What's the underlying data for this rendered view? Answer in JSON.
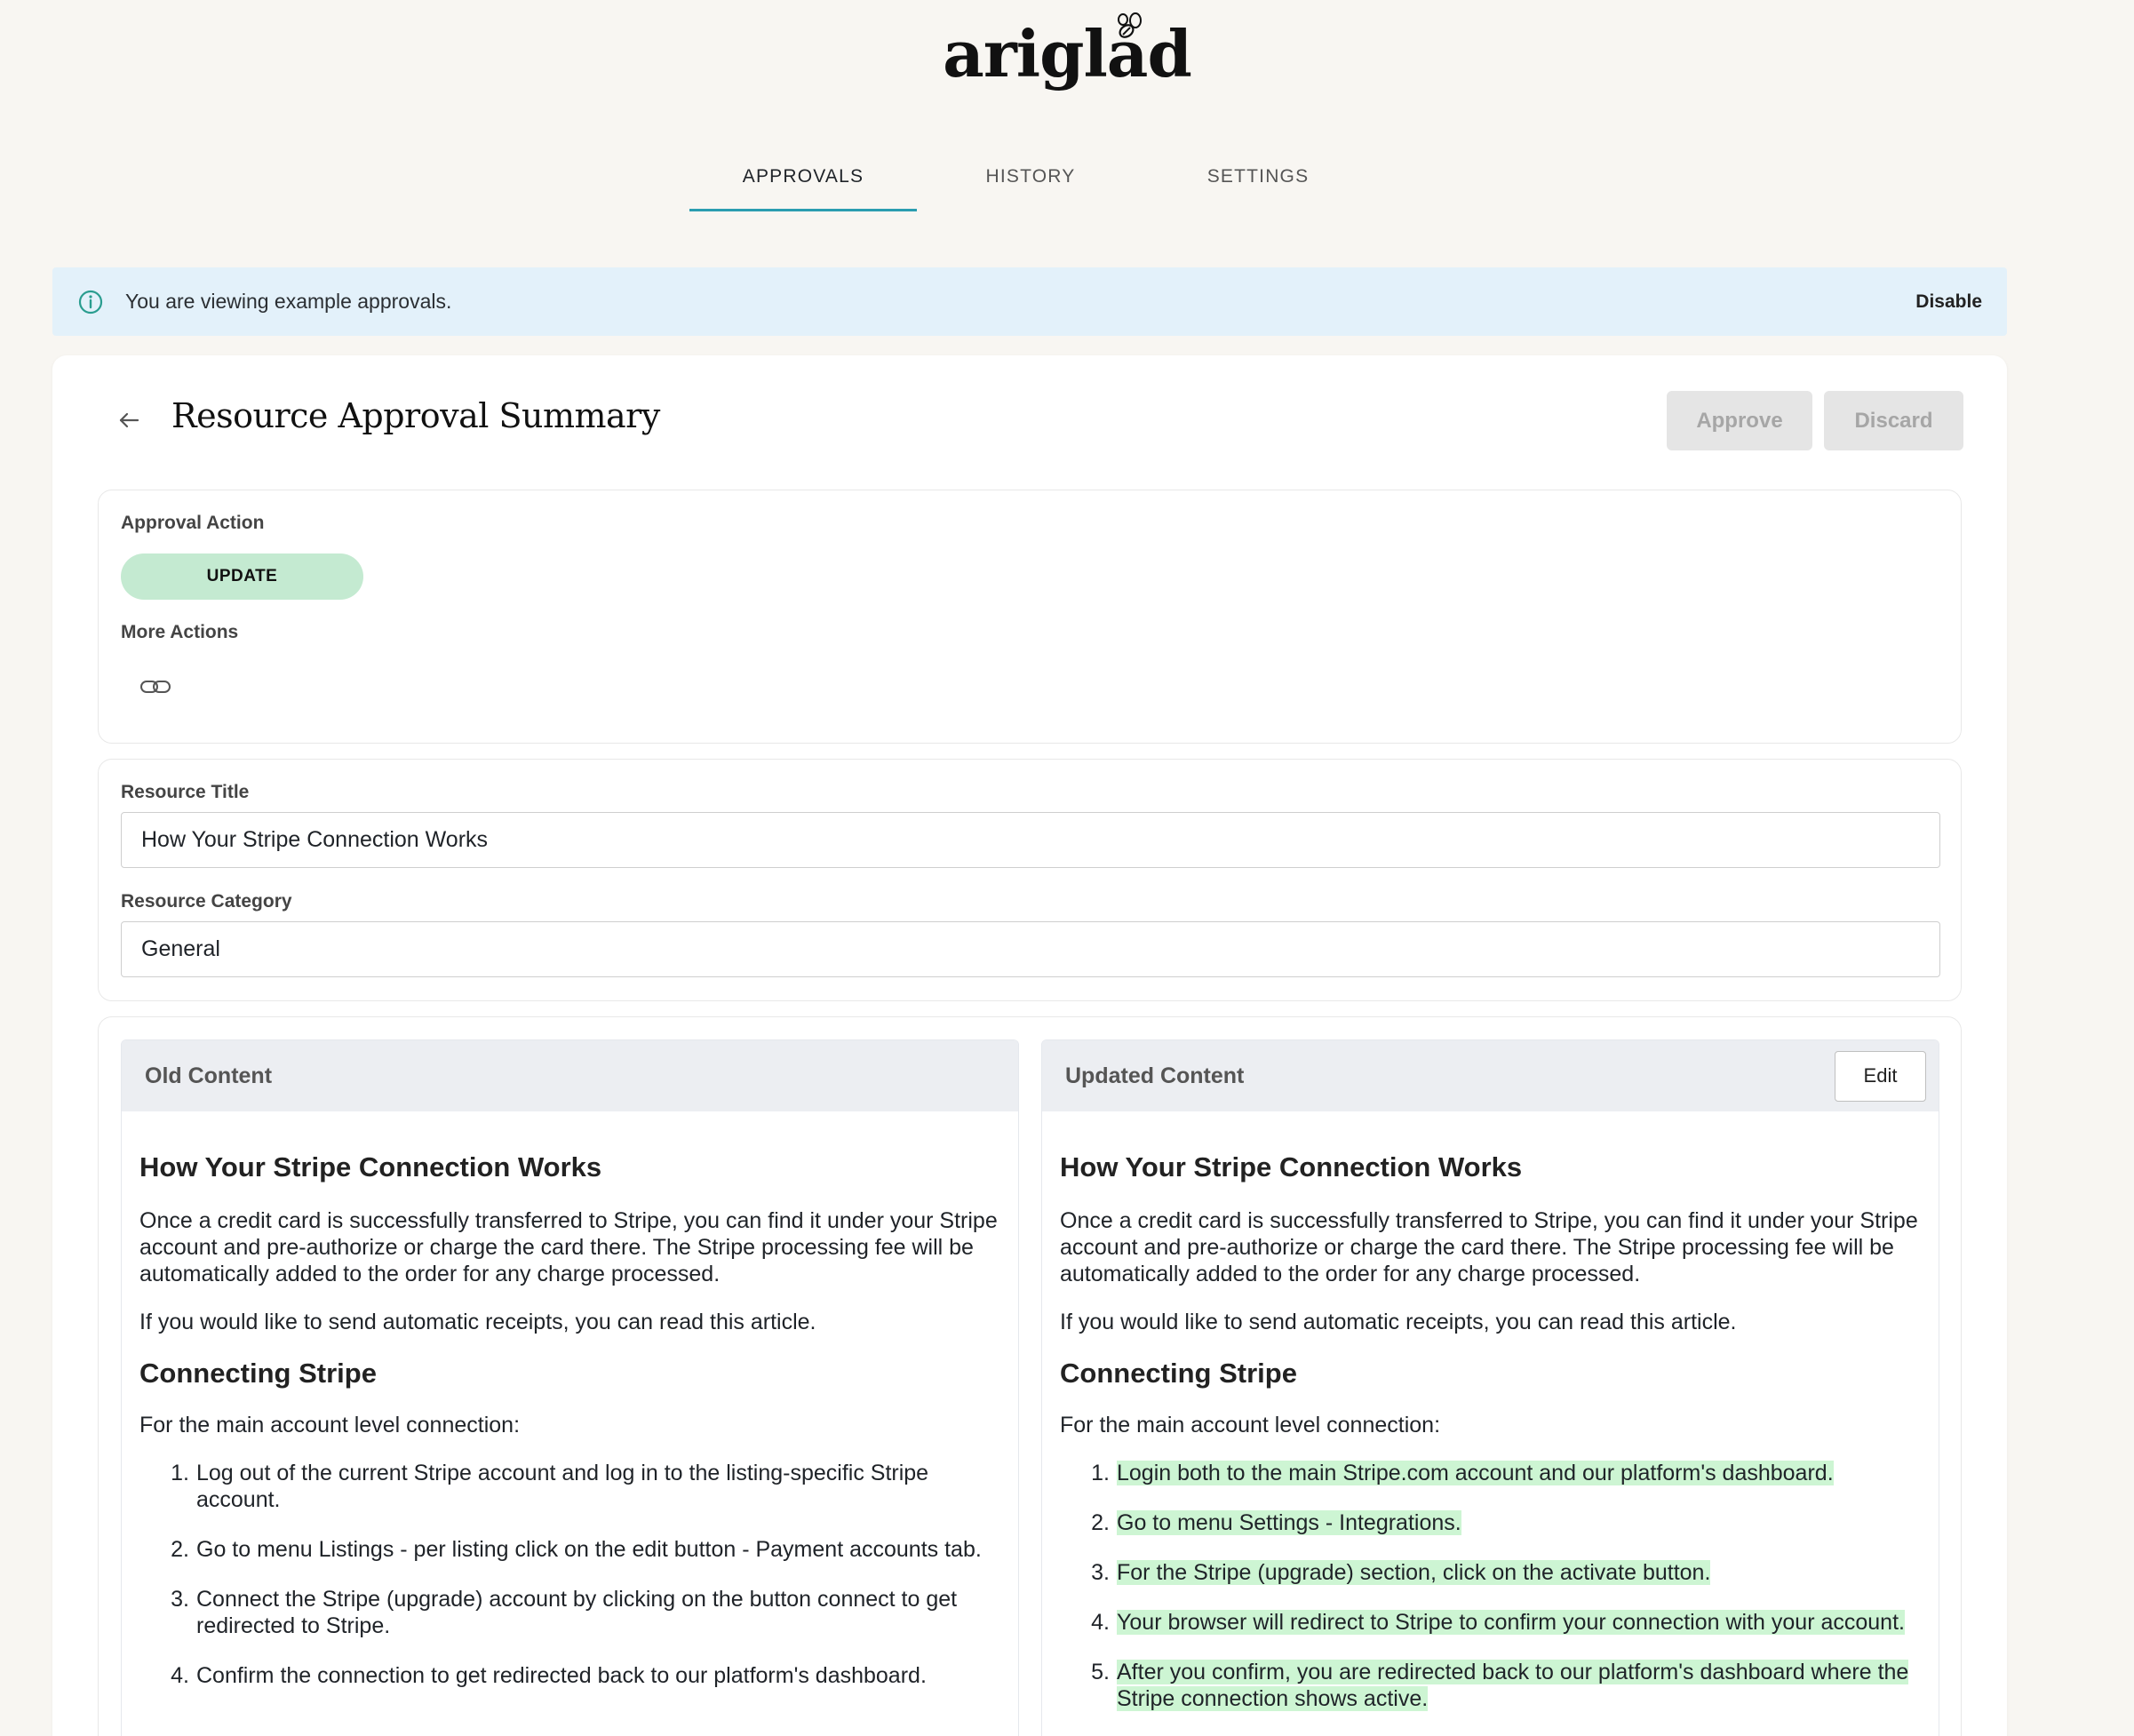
{
  "brand": {
    "logo_text": "ariglad"
  },
  "nav": {
    "tabs": [
      {
        "label": "APPROVALS",
        "active": true
      },
      {
        "label": "HISTORY",
        "active": false
      },
      {
        "label": "SETTINGS",
        "active": false
      }
    ]
  },
  "banner": {
    "icon": "info-icon",
    "text": "You are viewing example approvals.",
    "action_label": "Disable"
  },
  "header": {
    "title": "Resource Approval Summary",
    "approve_label": "Approve",
    "discard_label": "Discard"
  },
  "approval": {
    "action_label": "Approval Action",
    "action_value": "UPDATE",
    "more_actions_label": "More Actions",
    "more_actions_icon": "link-icon"
  },
  "resource": {
    "title_label": "Resource Title",
    "title_value": "How Your Stripe Connection Works",
    "category_label": "Resource Category",
    "category_value": "General"
  },
  "old_content": {
    "header": "Old Content",
    "heading": "How Your Stripe Connection Works",
    "paragraph_1": "Once a credit card is successfully transferred to Stripe, you can find it under your Stripe account and pre-authorize or charge the card there. The Stripe processing fee will be automatically added to the order for any charge processed.",
    "paragraph_2": "If you would like to send automatic receipts, you can read this article.",
    "subheading": "Connecting Stripe",
    "paragraph_3": "For the main account level connection:",
    "steps": [
      {
        "num": "1.",
        "text": "Log out of the current Stripe account and log in to the listing-specific Stripe account."
      },
      {
        "num": "2.",
        "text": "Go to menu Listings - per listing click on the edit button - Payment accounts tab."
      },
      {
        "num": "3.",
        "text": "Connect the Stripe (upgrade) account by clicking on the button connect to get redirected to Stripe."
      },
      {
        "num": "4.",
        "text": "Confirm the connection to get redirected back to our platform's dashboard."
      }
    ]
  },
  "new_content": {
    "header": "Updated Content",
    "edit_label": "Edit",
    "heading": "How Your Stripe Connection Works",
    "paragraph_1": "Once a credit card is successfully transferred to Stripe, you can find it under your Stripe account and pre-authorize or charge the card there. The Stripe processing fee will be automatically added to the order for any charge processed.",
    "paragraph_2": "If you would like to send automatic receipts, you can read this article.",
    "subheading": "Connecting Stripe",
    "paragraph_3": "For the main account level connection:",
    "highlight_color": "#cdf5d3",
    "steps": [
      {
        "num": "1.",
        "text": "Login both to the main Stripe.com account and our platform's dashboard."
      },
      {
        "num": "2.",
        "text": "Go to menu Settings - Integrations."
      },
      {
        "num": "3.",
        "text": "For the Stripe (upgrade) section, click on the activate button."
      },
      {
        "num": "4.",
        "text": "Your browser will redirect to Stripe to confirm your connection with your account."
      },
      {
        "num": "5.",
        "text": "After you confirm, you are redirected back to our platform's dashboard where the Stripe connection shows active."
      }
    ]
  },
  "colors": {
    "accent": "#2a9db0",
    "banner_bg": "#e3f1fa",
    "update_pill": "#c4ead1",
    "page_bg": "#f8f6f2"
  }
}
